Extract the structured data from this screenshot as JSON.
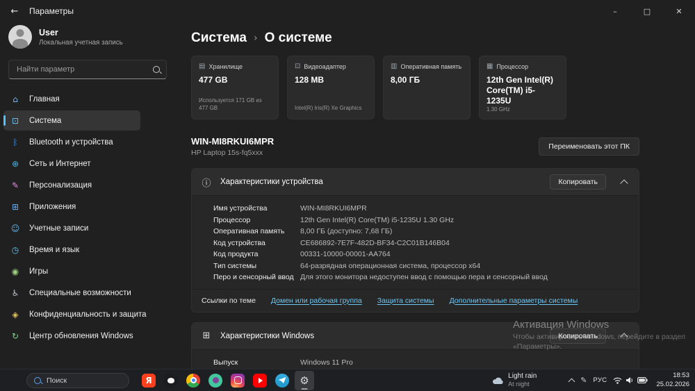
{
  "window": {
    "title": "Параметры",
    "icons": {
      "back": "←",
      "minimize": "–",
      "maximize": "□",
      "close": "✕"
    }
  },
  "sidebar": {
    "user": {
      "name": "User",
      "type": "Локальная учетная запись"
    },
    "search_placeholder": "Найти параметр",
    "items": [
      {
        "name": "sidebar-item-home",
        "icon": "home-icon",
        "glyph": "⌂",
        "color": "#7ab8f5",
        "label": "Главная"
      },
      {
        "name": "sidebar-item-system",
        "icon": "system-icon",
        "glyph": "⊡",
        "color": "#6fc1f2",
        "label": "Система",
        "selected": true
      },
      {
        "name": "sidebar-item-bluetooth",
        "icon": "bluetooth-icon",
        "glyph": "ᛒ",
        "color": "#3f9af5",
        "label": "Bluetooth и устройства"
      },
      {
        "name": "sidebar-item-network",
        "icon": "globe-icon",
        "glyph": "⊕",
        "color": "#49b6e8",
        "label": "Сеть и Интернет"
      },
      {
        "name": "sidebar-item-personalization",
        "icon": "brush-icon",
        "glyph": "✎",
        "color": "#dd8fd8",
        "label": "Персонализация"
      },
      {
        "name": "sidebar-item-apps",
        "icon": "apps-grid-icon",
        "glyph": "⊞",
        "color": "#6aaef2",
        "label": "Приложения"
      },
      {
        "name": "sidebar-item-accounts",
        "icon": "person-icon",
        "glyph": "☺",
        "color": "#5fb9f0",
        "label": "Учетные записи"
      },
      {
        "name": "sidebar-item-time-language",
        "icon": "clock-icon",
        "glyph": "◷",
        "color": "#64c6ef",
        "label": "Время и язык"
      },
      {
        "name": "sidebar-item-gaming",
        "icon": "gamepad-icon",
        "glyph": "◉",
        "color": "#9ed17d",
        "label": "Игры"
      },
      {
        "name": "sidebar-item-accessibility",
        "icon": "accessibility-icon",
        "glyph": "♿",
        "color": "#b8c3cf",
        "label": "Специальные возможности"
      },
      {
        "name": "sidebar-item-privacy",
        "icon": "shield-icon",
        "glyph": "◈",
        "color": "#e4c35e",
        "label": "Конфиденциальность и защита"
      },
      {
        "name": "sidebar-item-windows-update",
        "icon": "update-icon",
        "glyph": "↻",
        "color": "#7fd98e",
        "label": "Центр обновления Windows"
      }
    ]
  },
  "main": {
    "breadcrumb": {
      "root": "Система",
      "separator": "›",
      "current": "О системе"
    },
    "cards": [
      {
        "name": "card-storage",
        "icon": "storage-icon",
        "glyph": "▤",
        "label": "Хранилище",
        "value": "477 GB",
        "detail": "Используется 171 GB из 477 GB"
      },
      {
        "name": "card-gpu",
        "icon": "gpu-icon",
        "glyph": "⊡",
        "label": "Видеоадаптер",
        "value": "128 MB",
        "detail": "Intel(R) Iris(R) Xe Graphics"
      },
      {
        "name": "card-ram",
        "icon": "ram-icon",
        "glyph": "▥",
        "label": "Оперативная память",
        "value": "8,00 ГБ",
        "detail": ""
      },
      {
        "name": "card-cpu",
        "icon": "cpu-icon",
        "glyph": "▦",
        "label": "Процессор",
        "value": "12th Gen Intel(R) Core(TM) i5-1235U",
        "detail": "1.30 GHz"
      }
    ],
    "device": {
      "name": "WIN-MI8RKUI6MPR",
      "model": "HP Laptop 15s-fq5xxx",
      "rename_button": "Переименовать этот ПК"
    },
    "device_specs": {
      "icon": "ⓘ",
      "title": "Характеристики устройства",
      "copy_button": "Копировать",
      "rows": [
        {
          "label": "Имя устройства",
          "value": "WIN-MI8RKUI6MPR"
        },
        {
          "label": "Процессор",
          "value": "12th Gen Intel(R) Core(TM) i5-1235U   1.30 GHz"
        },
        {
          "label": "Оперативная память",
          "value": "8,00 ГБ (доступно: 7,68 ГБ)"
        },
        {
          "label": "Код устройства",
          "value": "CE686892-7E7F-482D-BF34-C2C01B146B04"
        },
        {
          "label": "Код продукта",
          "value": "00331-10000-00001-AA764"
        },
        {
          "label": "Тип системы",
          "value": "64-разрядная операционная система, процессор x64"
        },
        {
          "label": "Перо и сенсорный ввод",
          "value": "Для этого монитора недоступен ввод с помощью пера и сенсорный ввод"
        }
      ]
    },
    "related_links": {
      "label": "Ссылки по теме",
      "links": [
        "Домен или рабочая группа",
        "Защита системы",
        "Дополнительные параметры системы"
      ]
    },
    "windows_specs": {
      "icon": "⊞",
      "title": "Характеристики Windows",
      "copy_button": "Копировать",
      "rows": [
        {
          "label": "Выпуск",
          "value": "Windows 11 Pro"
        }
      ]
    }
  },
  "watermark": {
    "line1": "Активация Windows",
    "line2": "Чтобы активировать Windows, перейдите в раздел",
    "line3": "«Параметры»."
  },
  "taskbar": {
    "search_placeholder": "Поиск",
    "apps": [
      {
        "name": "yandex-browser-icon",
        "glyph": "Я"
      },
      {
        "name": "github-icon",
        "glyph": ""
      },
      {
        "name": "chrome-icon",
        "glyph": ""
      },
      {
        "name": "tor-browser-icon",
        "glyph": ""
      },
      {
        "name": "instagram-icon",
        "glyph": ""
      },
      {
        "name": "youtube-icon",
        "glyph": ""
      },
      {
        "name": "telegram-icon",
        "glyph": ""
      },
      {
        "name": "settings-app-icon",
        "glyph": "⚙",
        "active": true
      }
    ],
    "weather": {
      "line1": "Light rain",
      "line2": "At night"
    },
    "tray": {
      "pen_glyph": "✎",
      "language": "РУС",
      "time": "18:53",
      "date": "25.02.2026"
    }
  },
  "theme": {
    "accent": "#4cc2ff",
    "link": "#6ec6f2",
    "card_bg": "#2b2b2b",
    "page_bg": "#202020"
  }
}
